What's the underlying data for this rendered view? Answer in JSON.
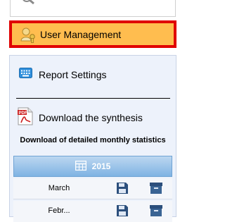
{
  "menu": {
    "user_management_label": "User Management",
    "report_settings_label": "Report Settings",
    "download_synthesis_label": "Download the synthesis",
    "detailed_stats_heading": "Download of detailed monthly statistics"
  },
  "stats": {
    "year": "2015",
    "months": [
      "March",
      "Febr..."
    ]
  },
  "colors": {
    "highlight_bg": "#ffbd4f",
    "highlight_border": "#e00000",
    "panel_bg": "#edf2fb",
    "year_bar": "#7fb3e3",
    "action_icon": "#2c4f7c"
  },
  "icons": {
    "partial_top": "magnifier-icon",
    "user_management": "user-key-icon",
    "report_settings": "keyboard-icon",
    "download": "pdf-icon",
    "year": "calendar-grid-icon",
    "save": "floppy-disk-icon",
    "archive": "archive-box-icon"
  }
}
